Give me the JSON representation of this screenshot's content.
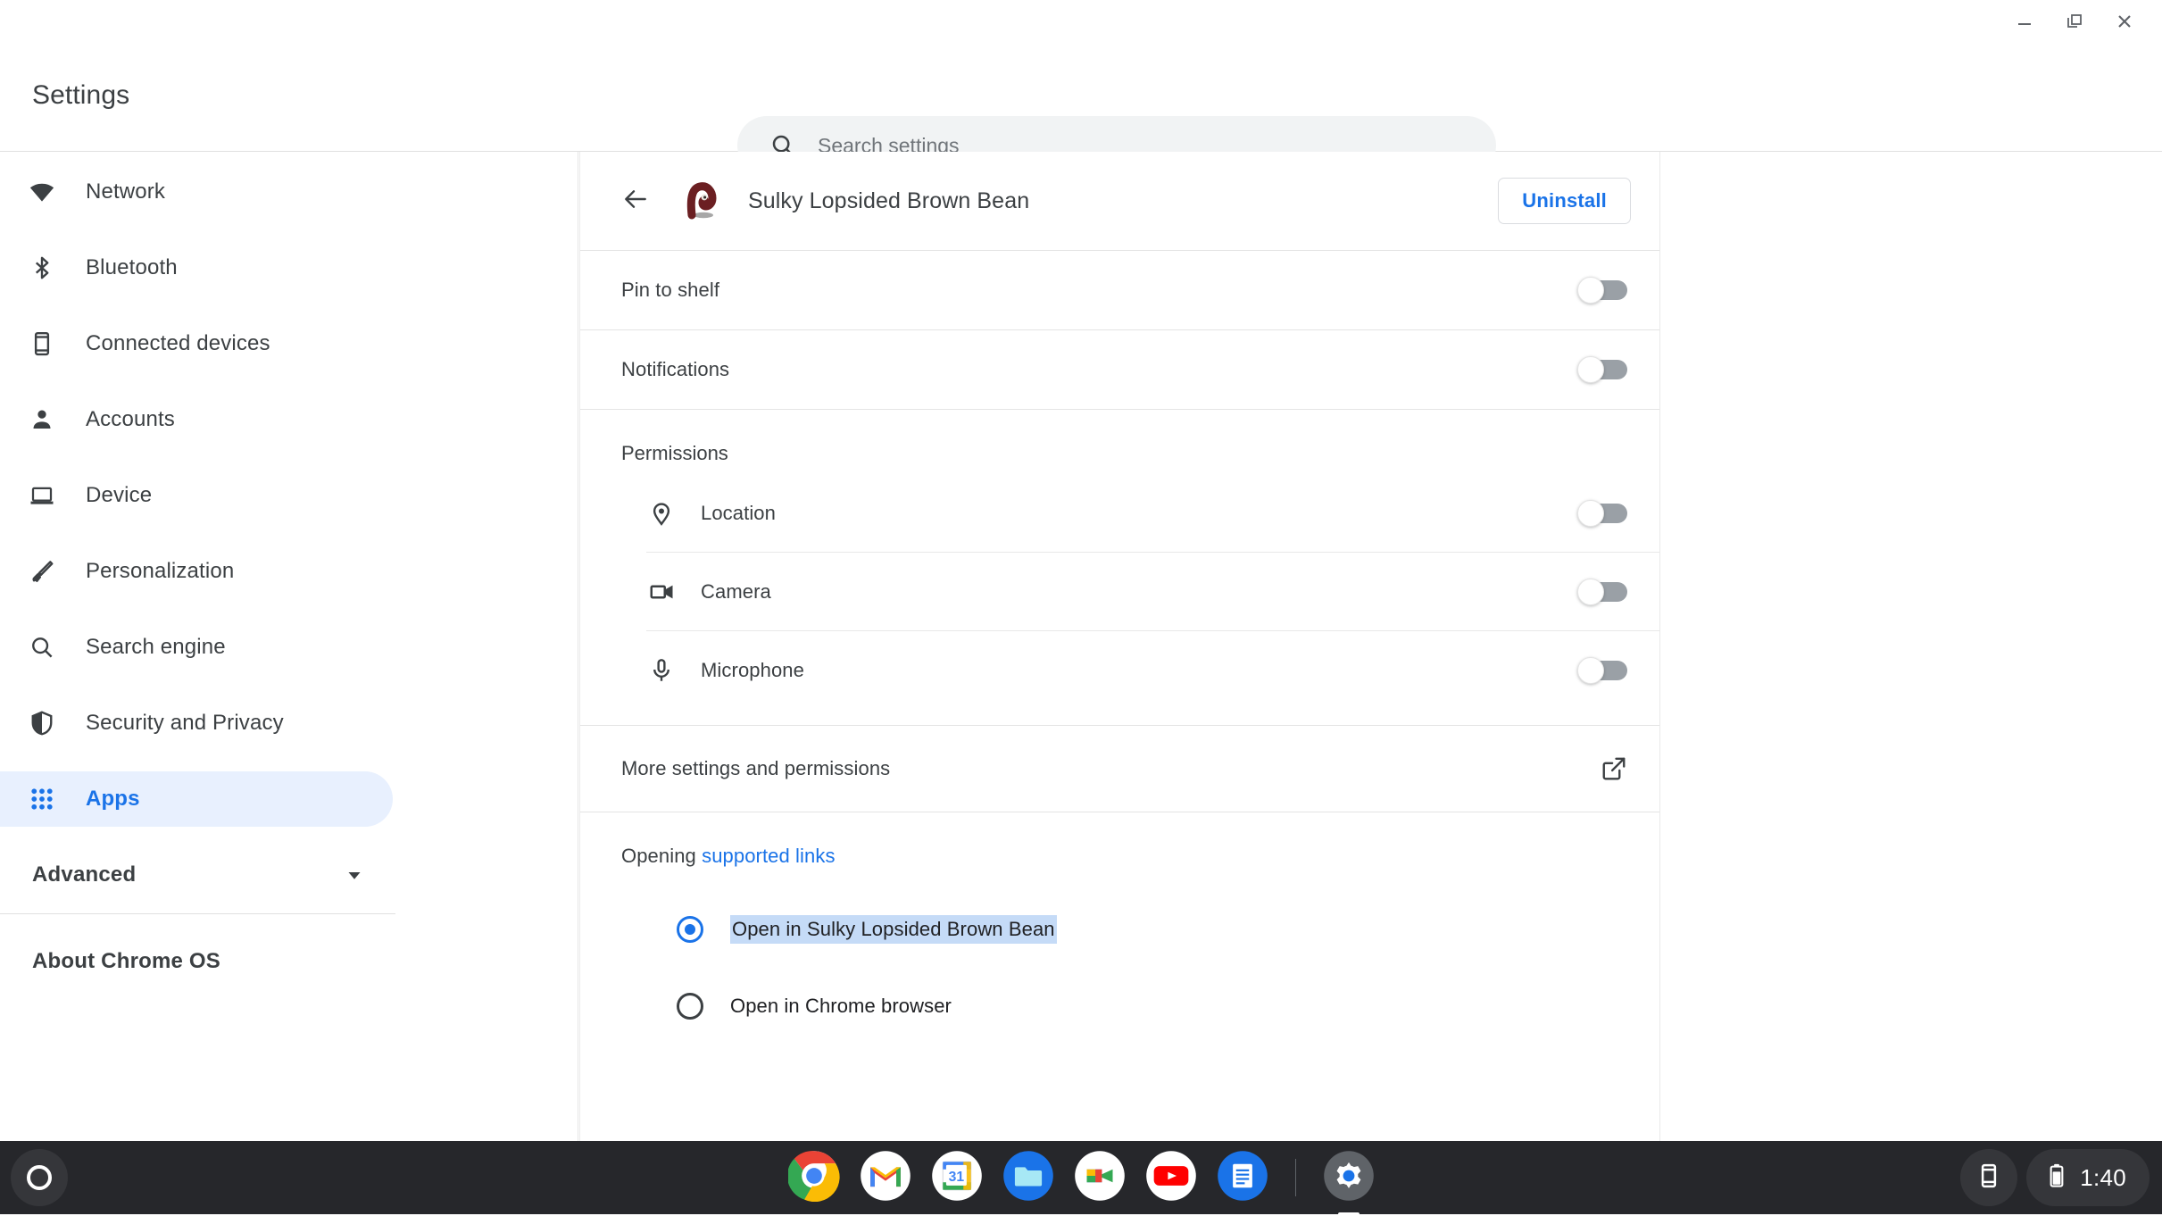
{
  "window_controls": {
    "minimize": {
      "icon": "minimize-icon",
      "label": "Minimize"
    },
    "restore": {
      "icon": "restore-icon",
      "label": "Restore"
    },
    "close": {
      "icon": "close-icon",
      "label": "Close"
    }
  },
  "topbar": {
    "brand": "Settings",
    "search": {
      "icon": "search-icon",
      "placeholder": "Search settings",
      "value": ""
    }
  },
  "sidebar": {
    "items": [
      {
        "label": "Network",
        "icon": "wifi-icon",
        "selected": false
      },
      {
        "label": "Bluetooth",
        "icon": "bluetooth-icon",
        "selected": false
      },
      {
        "label": "Connected devices",
        "icon": "phone-icon",
        "selected": false
      },
      {
        "label": "Accounts",
        "icon": "person-icon",
        "selected": false
      },
      {
        "label": "Device",
        "icon": "laptop-icon",
        "selected": false
      },
      {
        "label": "Personalization",
        "icon": "brush-icon",
        "selected": false
      },
      {
        "label": "Search engine",
        "icon": "search-icon",
        "selected": false
      },
      {
        "label": "Security and Privacy",
        "icon": "shield-icon",
        "selected": false
      },
      {
        "label": "Apps",
        "icon": "apps-grid-icon",
        "selected": true
      }
    ],
    "advanced": {
      "label": "Advanced",
      "icon": "chevron-down-icon"
    },
    "about": {
      "label": "About Chrome OS"
    },
    "accent_color": "#1a73e8",
    "selected_bg": "#e8f0fe"
  },
  "app_detail": {
    "back": {
      "icon": "back-arrow-icon",
      "label": "Back"
    },
    "app_icon": "sulky-lopsided-brown-bean-app-icon",
    "title": "Sulky Lopsided Brown Bean",
    "uninstall_label": "Uninstall",
    "toggles": [
      {
        "label": "Pin to shelf",
        "state": "off"
      },
      {
        "label": "Notifications",
        "state": "off"
      }
    ],
    "permissions": {
      "heading": "Permissions",
      "rows": [
        {
          "label": "Location",
          "icon": "location-pin-icon",
          "state": "off"
        },
        {
          "label": "Camera",
          "icon": "camera-icon",
          "state": "off"
        },
        {
          "label": "Microphone",
          "icon": "microphone-icon",
          "state": "off"
        }
      ]
    },
    "more_settings": {
      "label": "More settings and permissions",
      "icon": "external-link-icon"
    },
    "supported_links": {
      "title_prefix": "Opening ",
      "title_link": "supported links",
      "options": [
        {
          "label": "Open in Sulky Lopsided Brown Bean",
          "selected": true,
          "highlighted": true
        },
        {
          "label": "Open in Chrome browser",
          "selected": false,
          "highlighted": false
        }
      ]
    }
  },
  "shelf": {
    "launcher": {
      "icon": "launcher-circle-icon",
      "label": "Launcher"
    },
    "apps": [
      {
        "name": "Chrome",
        "icon": "chrome-icon",
        "active": false
      },
      {
        "name": "Gmail",
        "icon": "gmail-icon",
        "active": false
      },
      {
        "name": "Calendar",
        "icon": "calendar-icon",
        "active": false,
        "day": "31"
      },
      {
        "name": "Files",
        "icon": "files-icon",
        "active": false
      },
      {
        "name": "Meet",
        "icon": "meet-icon",
        "active": false
      },
      {
        "name": "YouTube",
        "icon": "youtube-icon",
        "active": false
      },
      {
        "name": "Docs",
        "icon": "docs-icon",
        "active": false
      },
      {
        "name": "Settings",
        "icon": "settings-gear-icon",
        "active": true
      }
    ],
    "status": {
      "phone_hub_icon": "phone-hub-icon",
      "battery_icon": "battery-icon",
      "clock": "1:40"
    }
  }
}
